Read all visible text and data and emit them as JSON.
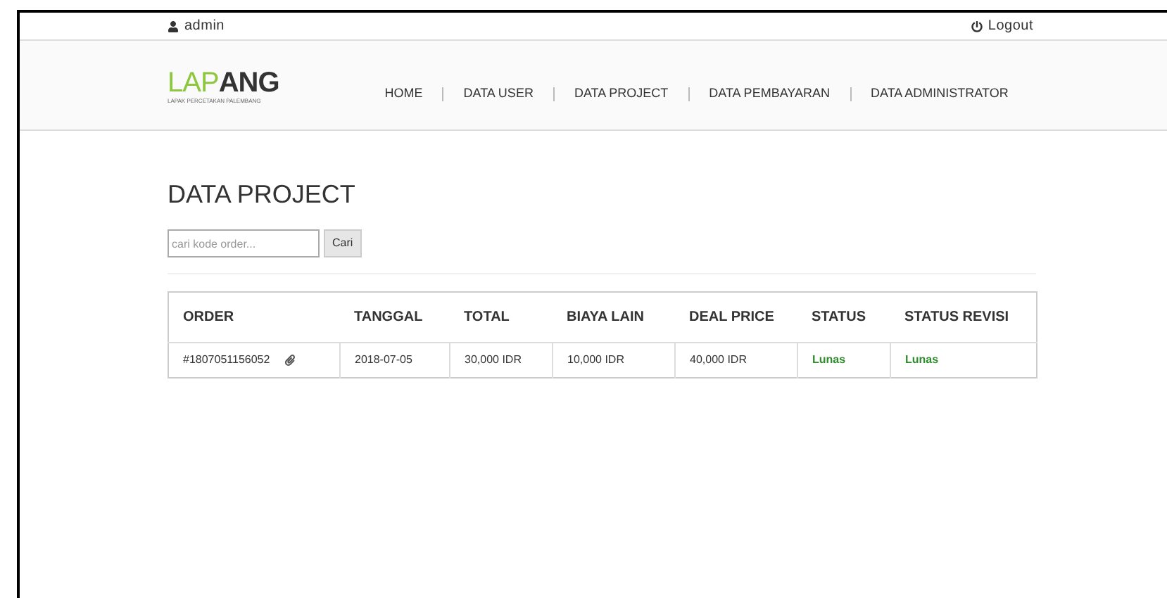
{
  "top_bar": {
    "user": "admin",
    "logout": "Logout"
  },
  "logo": {
    "accent": "LAP",
    "rest": "ANG",
    "tagline": "LAPAK PERCETAKAN PALEMBANG"
  },
  "nav": [
    "HOME",
    "DATA USER",
    "DATA PROJECT",
    "DATA PEMBAYARAN",
    "DATA ADMINISTRATOR"
  ],
  "page_title": "DATA PROJECT",
  "search": {
    "placeholder": "cari kode order...",
    "button": "Cari"
  },
  "table": {
    "columns": [
      "ORDER",
      "TANGGAL",
      "TOTAL",
      "BIAYA LAIN",
      "DEAL PRICE",
      "STATUS",
      "STATUS REVISI"
    ],
    "rows": [
      {
        "order": "#1807051156052",
        "tanggal": "2018-07-05",
        "total": "30,000 IDR",
        "biaya_lain": "10,000 IDR",
        "deal_price": "40,000 IDR",
        "status": "Lunas",
        "status_revisi": "Lunas"
      }
    ]
  }
}
